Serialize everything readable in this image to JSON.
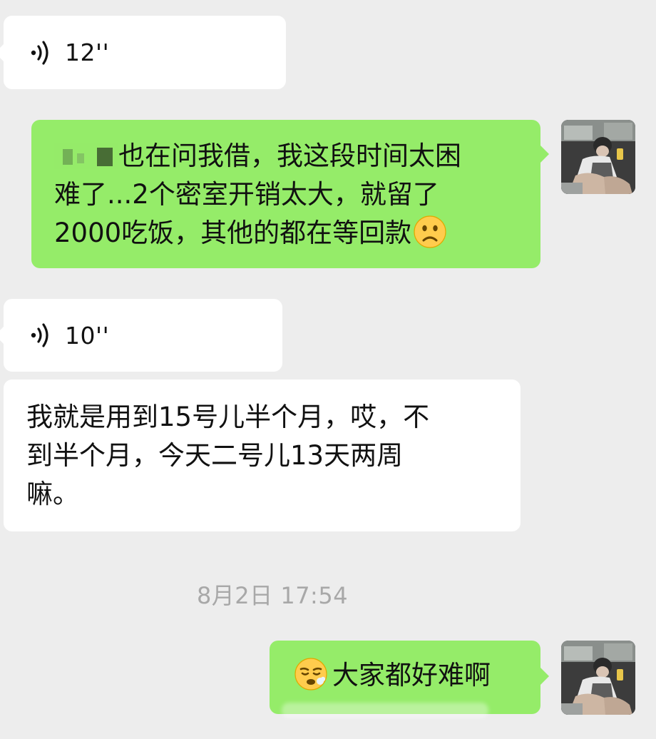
{
  "messages": [
    {
      "type": "voice",
      "side": "incoming",
      "duration": "12''"
    },
    {
      "type": "text",
      "side": "outgoing",
      "redacted_prefix": true,
      "lines": [
        "也在问我借，我这段时间太困",
        "难了...2个密室开销太大，就留了",
        "2000吃饭，其他的都在等回款"
      ],
      "trailing_emoji": "frowning-face"
    },
    {
      "type": "voice",
      "side": "incoming",
      "duration": "10''"
    },
    {
      "type": "text",
      "side": "incoming",
      "lines": [
        "我就是用到15号儿半个月，哎，不",
        "到半个月，今天二号儿13天两周",
        "嘛。"
      ]
    },
    {
      "type": "timestamp",
      "text": "8月2日 17:54"
    },
    {
      "type": "text",
      "side": "outgoing",
      "leading_emoji": "persevering-face",
      "text": "大家都好难啊"
    }
  ],
  "colors": {
    "background": "#ededed",
    "incoming_bubble": "#ffffff",
    "outgoing_bubble": "#95ec69",
    "timestamp_text": "#a8a8a8"
  }
}
